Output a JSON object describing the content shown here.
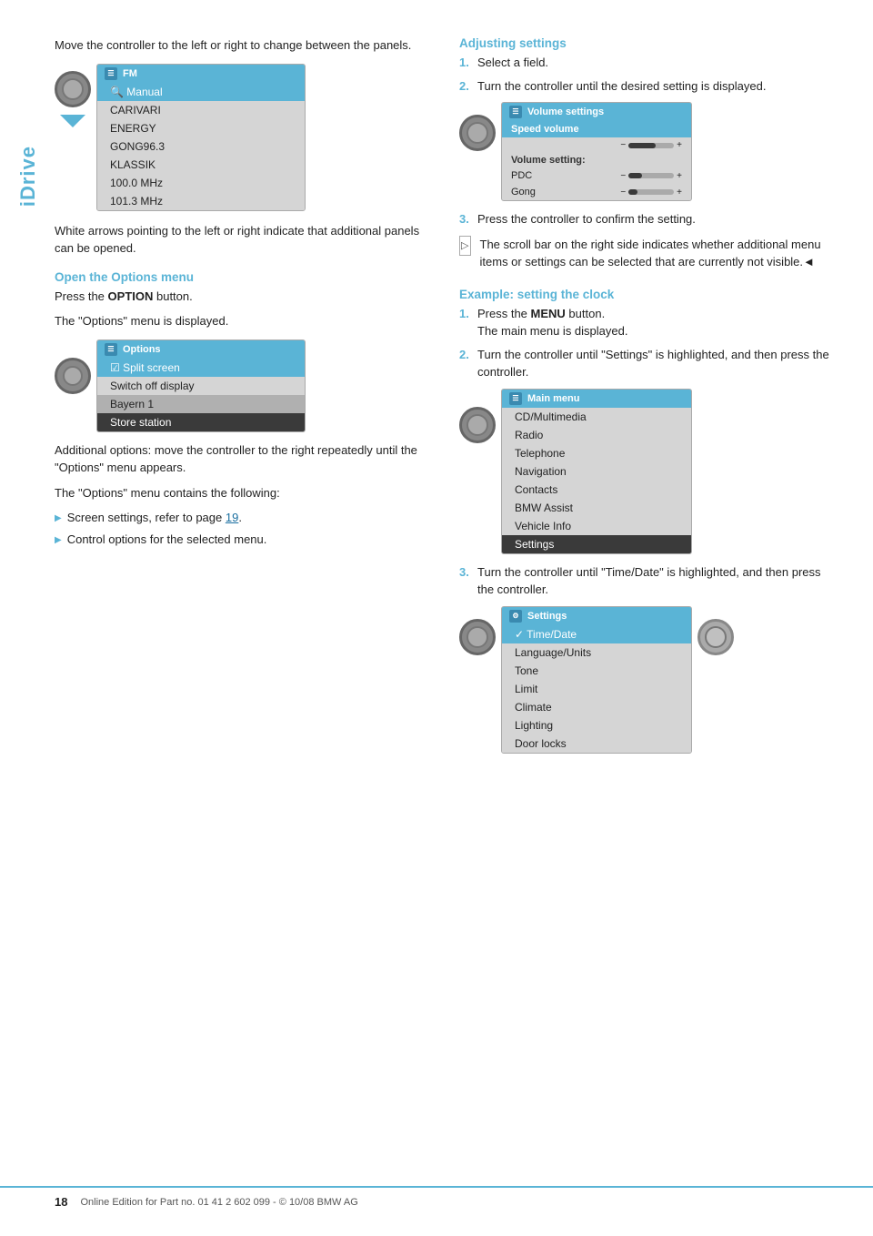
{
  "sidebar": {
    "label": "iDrive"
  },
  "left_col": {
    "intro_text": "Move the controller to the left or right to change between the panels.",
    "fm_screen": {
      "title": "FM",
      "items": [
        {
          "text": "Manual",
          "type": "highlighted"
        },
        {
          "text": "CARIVARI",
          "type": "normal"
        },
        {
          "text": "ENERGY",
          "type": "normal"
        },
        {
          "text": "GONG96.3",
          "type": "normal"
        },
        {
          "text": "KLASSIK",
          "type": "normal"
        },
        {
          "text": "100.0 MHz",
          "type": "normal"
        },
        {
          "text": "101.3 MHz",
          "type": "normal"
        }
      ]
    },
    "arrows_note": "White arrows pointing to the left or right indicate that additional panels can be opened.",
    "open_options_heading": "Open the Options menu",
    "press_option_text1": "Press the ",
    "press_option_bold": "OPTION",
    "press_option_text2": " button.",
    "options_displayed": "The \"Options\" menu is displayed.",
    "options_screen": {
      "title": "Options",
      "items": [
        {
          "text": "Split screen",
          "type": "checkbox",
          "checked": true
        },
        {
          "text": "Switch off display",
          "type": "normal"
        },
        {
          "text": "Bayern 1",
          "type": "dark"
        },
        {
          "text": "Store station",
          "type": "selected"
        }
      ]
    },
    "additional_options": "Additional options: move the controller to the right repeatedly until the \"Options\" menu appears.",
    "options_contains": "The \"Options\" menu contains the following:",
    "bullet_items": [
      {
        "text": "Screen settings, refer to page ",
        "link": "19",
        "suffix": "."
      },
      {
        "text": "Control options for the selected menu.",
        "link": null,
        "suffix": ""
      }
    ]
  },
  "right_col": {
    "adjusting_heading": "Adjusting settings",
    "steps_adjust": [
      {
        "num": "1.",
        "text": "Select a field."
      },
      {
        "num": "2.",
        "text": "Turn the controller until the desired setting is displayed."
      }
    ],
    "vol_screen": {
      "title": "Volume settings",
      "section": "Speed volume",
      "sub_label": "Volume setting:",
      "items": [
        {
          "label": "PDC",
          "fill_pct": 30
        },
        {
          "label": "Gong",
          "fill_pct": 20
        }
      ]
    },
    "step3_text": "Press the controller to confirm the setting.",
    "scroll_indicator_text": "The scroll bar on the right side indicates whether additional menu items or settings can be selected that are currently not visible.",
    "scroll_suffix": "◄",
    "example_heading": "Example: setting the clock",
    "example_steps": [
      {
        "num": "1.",
        "bold": "MENU",
        "pre": "Press the ",
        "post": " button.\nThe main menu is displayed."
      },
      {
        "num": "2.",
        "text": "Turn the controller until \"Settings\" is highlighted, and then press the controller."
      }
    ],
    "main_menu_screen": {
      "title": "Main menu",
      "items": [
        {
          "text": "CD/Multimedia",
          "type": "normal"
        },
        {
          "text": "Radio",
          "type": "normal"
        },
        {
          "text": "Telephone",
          "type": "normal"
        },
        {
          "text": "Navigation",
          "type": "normal"
        },
        {
          "text": "Contacts",
          "type": "normal"
        },
        {
          "text": "BMW Assist",
          "type": "normal"
        },
        {
          "text": "Vehicle Info",
          "type": "normal"
        },
        {
          "text": "Settings",
          "type": "selected"
        }
      ]
    },
    "step3_settings": "Turn the controller until \"Time/Date\" is highlighted, and then press the controller.",
    "settings_screen": {
      "title": "Settings",
      "items": [
        {
          "text": "Time/Date",
          "type": "highlighted",
          "checked": true
        },
        {
          "text": "Language/Units",
          "type": "normal"
        },
        {
          "text": "Tone",
          "type": "normal"
        },
        {
          "text": "Limit",
          "type": "normal"
        },
        {
          "text": "Climate",
          "type": "normal"
        },
        {
          "text": "Lighting",
          "type": "normal"
        },
        {
          "text": "Door locks",
          "type": "normal"
        }
      ]
    }
  },
  "footer": {
    "page_number": "18",
    "text": "Online Edition for Part no. 01 41 2 602 099 - © 10/08 BMW AG"
  }
}
